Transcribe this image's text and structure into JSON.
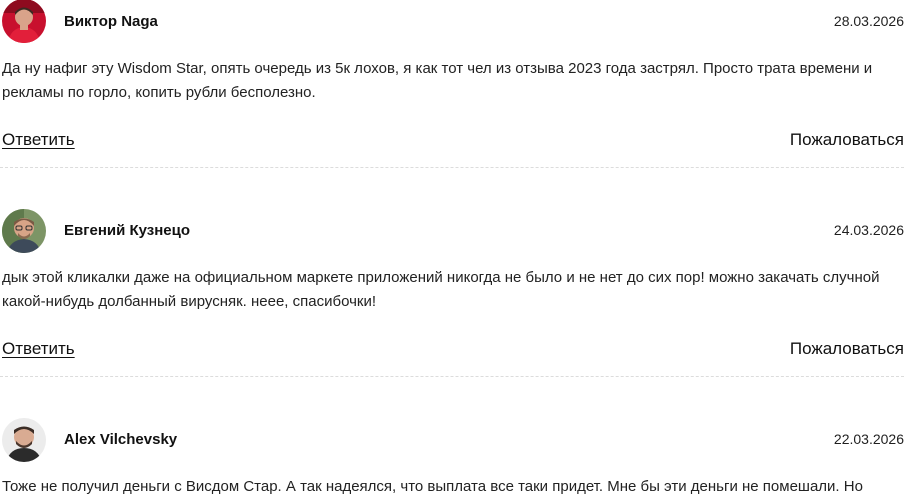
{
  "comments": [
    {
      "author": "Виктор Naga",
      "date": "28.03.2026",
      "text": "Да ну нафиг эту Wisdom Star, опять очередь из 5к лохов, я как тот чел из отзыва 2023 года застрял. Просто трата времени и рекламы по горло, копить рубли бесполезно.",
      "reply_label": "Ответить",
      "report_label": "Пожаловаться"
    },
    {
      "author": "Евгений Кузнецо",
      "date": "24.03.2026",
      "text": "дык этой кликалки даже на официальном маркете приложений никогда не было и не нет до сих пор! можно закачать случной какой-нибудь долбанный вирусняк. неее, спасибочки!",
      "reply_label": "Ответить",
      "report_label": "Пожаловаться"
    },
    {
      "author": "Alex Vilchevsky",
      "date": "22.03.2026",
      "text": "Тоже не получил деньги с Висдом Стар. А так надеялся, что выплата все таки придет. Мне бы эти деньги не помешали. Но"
    }
  ],
  "colors": {
    "text": "#222222",
    "divider": "#dcdcdc",
    "avatar1_bg": "#c8102e",
    "avatar2_bg": "#6e8a5a",
    "avatar3_bg": "#f2f2f2"
  }
}
